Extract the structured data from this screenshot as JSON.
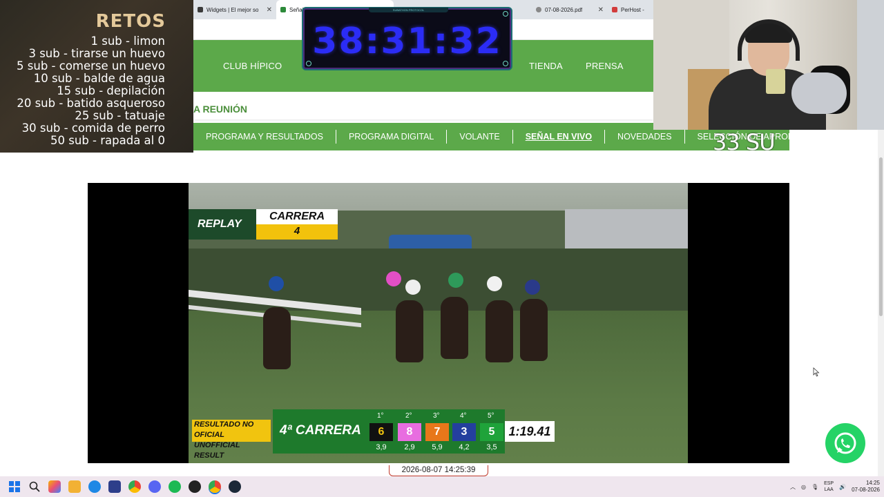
{
  "browser": {
    "tabs": [
      {
        "label": "Widgets | El mejor so",
        "color": "#3b3b3b"
      },
      {
        "label": "Señal",
        "color": "#2d8a3a"
      },
      {
        "label": "07-08-2026.pdf",
        "color": "#888888"
      },
      {
        "label": "PerHost -",
        "color": "#d23c3c"
      }
    ]
  },
  "site": {
    "nav": {
      "club": "CLUB HÍPICO",
      "tienda": "TIENDA",
      "prensa": "PRENSA"
    },
    "reunion": "A REUNIÓN",
    "subnav": [
      "PROGRAMA Y RESULTADOS",
      "PROGRAMA DIGITAL",
      "VOLANTE",
      "SEÑAL EN VIVO",
      "NOVEDADES",
      "SELECCIÓN DE APRONTES"
    ]
  },
  "retos": {
    "title": "RETOS",
    "items": [
      "1 sub - limon",
      "3 sub - tirarse un huevo",
      "5 sub - comerse un huevo",
      "10 sub - balde de agua",
      "15 sub - depilación",
      "20 sub - batido asqueroso",
      "25 sub - tatuaje",
      "30 sub - comida de perro",
      "50 sub - rapada al 0"
    ]
  },
  "countdown": {
    "header": "SUBATHON PROTOCOL",
    "time": "38:31:32"
  },
  "subcount": "33 SU",
  "video": {
    "replay_label": "REPLAY",
    "carrera_label": "CARRERA",
    "carrera_num": "4",
    "unofficial_line1": "RESULTADO NO OFICIAL",
    "unofficial_line2": "UNOFFICIAL RESULT",
    "race_name": "4ª CARRERA",
    "positions": [
      {
        "label": "1°",
        "num": "6",
        "odds": "3,9",
        "bg": "#111111",
        "fg": "#f1c40f"
      },
      {
        "label": "2°",
        "num": "8",
        "odds": "2,9",
        "bg": "#e86de0",
        "fg": "#ffffff"
      },
      {
        "label": "3°",
        "num": "7",
        "odds": "5,9",
        "bg": "#e8771a",
        "fg": "#ffffff"
      },
      {
        "label": "4°",
        "num": "3",
        "odds": "4,2",
        "bg": "#243f9e",
        "fg": "#ffffff"
      },
      {
        "label": "5°",
        "num": "5",
        "odds": "3,5",
        "bg": "#1fa33a",
        "fg": "#ffffff"
      }
    ],
    "race_time": "1:19.41"
  },
  "timestamp": "2026-08-07 14:25:39",
  "taskbar": {
    "lang1": "ESP",
    "lang2": "LAA",
    "time": "14:25",
    "date": "07-08-2026"
  },
  "colors": {
    "site_green": "#5ca94a",
    "countdown_blue": "#2b2cf5"
  }
}
